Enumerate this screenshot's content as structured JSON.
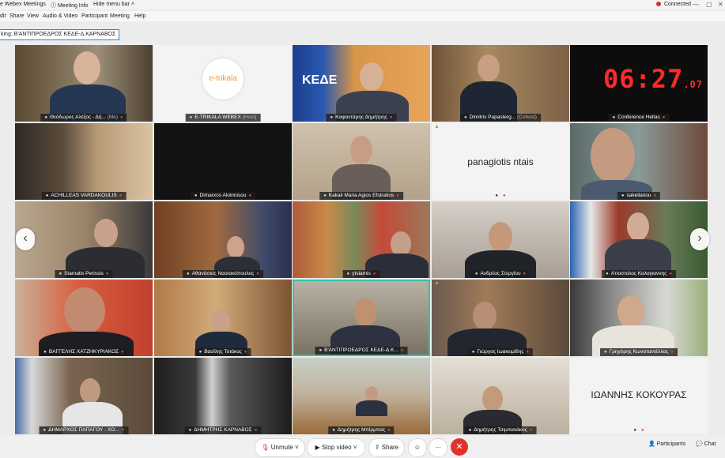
{
  "app": {
    "title": "e Webex Meetings",
    "meeting_info": "Meeting Info",
    "hide_menu": "Hide menu bar",
    "connection": "Connected"
  },
  "menu": [
    "dit",
    "Share",
    "View",
    "Audio & Video",
    "Participant",
    "Meeting",
    "Help"
  ],
  "speaking": "king: Β'ΑΝΤΙΠΡΟΕΔΡΟΣ ΚΕΔΕ-Δ.ΚΑΡΝΑΒΟΣ",
  "tiles": [
    {
      "name": "Θεόδωρος Αλέξος - Δή...",
      "suffix": "(Me)"
    },
    {
      "name": "E-TRIKALA WEBEX",
      "suffix": "(Host)",
      "logo": "e-trikala"
    },
    {
      "name": "Καφαντάρης Δημήτρης"
    },
    {
      "name": "Dimitris Papasterg...",
      "suffix": "(Cohost)"
    },
    {
      "name": "Conference Hellas"
    },
    {
      "name": "ACHILLEAS VARDAKOULIS"
    },
    {
      "name": "Dimarxos Aloinnisou"
    },
    {
      "name": "Kakali Maria Agios Efstratios"
    },
    {
      "name": "",
      "big_text": "panagiotis ntais"
    },
    {
      "name": "sakellariou"
    },
    {
      "name": "Stamatis Perissis"
    },
    {
      "name": "Αθανάσιος Νασιακόπουλος"
    },
    {
      "name": "ytsiamis"
    },
    {
      "name": "Ανδρέας Στεργίου"
    },
    {
      "name": "Αποστολος Καλογιαννης"
    },
    {
      "name": "ΒΑΓΓΕΛΗΣ ΧΑΤΖΗΚΥΡΙΑΚΟΣ"
    },
    {
      "name": "Βασίλης Τσιάκος"
    },
    {
      "name": "Β'ΑΝΤΙΠΡΟΕΔΡΟΣ ΚΕΔΕ-Δ.Κ..."
    },
    {
      "name": "Γιώργος Ιωακειμίδης"
    },
    {
      "name": "Γρηγόρης Κωνσταντέλλος"
    },
    {
      "name": "ΔΗΜΑΡΧΟΣ ΠΑΠΑΓΟΥ - ΧΟ..."
    },
    {
      "name": "ΔΗΜΗΤΡΗΣ ΚΑΡΝΑΒΟΣ"
    },
    {
      "name": "Δημήτρης Μπίρμπας"
    },
    {
      "name": "Δημήτρης Τσιμπανάκος"
    },
    {
      "name": "",
      "big_text": "ΙΩΑΝΝΗΣ ΚΟΚΟΥΡΑΣ"
    }
  ],
  "clock": {
    "main": "06:27",
    "sub": ".07"
  },
  "kede_logo": "ΚΕΔΕ",
  "controls": {
    "unmute": "Unmute",
    "stop_video": "Stop video",
    "share": "Share",
    "more": "···",
    "participants": "Participants",
    "chat": "Chat"
  },
  "icons": {
    "mic": "mic-icon",
    "mute": "mic-muted-icon",
    "video": "camera-icon",
    "share": "share-icon",
    "reactions": "smiley-icon",
    "leave": "close-icon"
  }
}
